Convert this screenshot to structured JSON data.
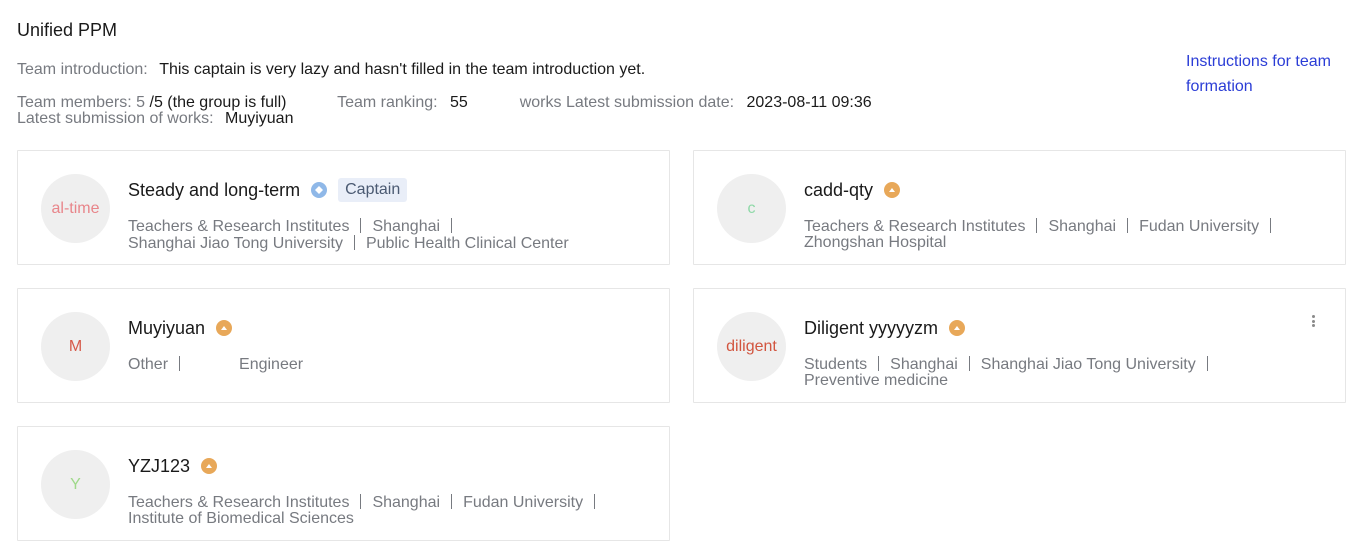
{
  "team": {
    "name": "Unified PPM",
    "intro_label": "Team introduction:",
    "intro_text": "This captain is very lazy and hasn't filled in the team introduction yet.",
    "members_label": "Team members: 5",
    "members_value": "/5 (the group is full)",
    "ranking_label": "Team ranking:",
    "ranking_value": "55",
    "works_date_label": "works Latest submission date:",
    "works_date_value": "2023-08-11 09:36",
    "latest_submitter_label": "Latest submission of works:",
    "latest_submitter_value": "Muyiyuan"
  },
  "instructions_link": "Instructions for team formation",
  "members": [
    {
      "avatar_text": "al-time",
      "avatar_color": "#e8858a",
      "name": "Steady and long-term",
      "role": "captain",
      "tag": "Captain",
      "line1": [
        "Teachers & Research Institutes",
        "Shanghai",
        ""
      ],
      "line2": [
        "Shanghai Jiao Tong University",
        "Public Health Clinical Center"
      ]
    },
    {
      "avatar_text": "c",
      "avatar_color": "#8fd9a8",
      "name": "cadd-qty",
      "role": "member",
      "line1": [
        "Teachers & Research Institutes",
        "Shanghai",
        "Fudan University",
        ""
      ],
      "line2": [
        "Zhongshan Hospital"
      ]
    },
    {
      "avatar_text": "M",
      "avatar_color": "#d65a4a",
      "name": "Muyiyuan",
      "role": "member",
      "line1": [
        "Other",
        "Engineer"
      ],
      "line2": []
    },
    {
      "avatar_text": "diligent",
      "avatar_color": "#d2553f",
      "name": "Diligent yyyyyzm",
      "role": "member",
      "line1": [
        "Students",
        "Shanghai",
        "Shanghai Jiao Tong University",
        ""
      ],
      "line2": [
        "Preventive medicine"
      ]
    },
    {
      "avatar_text": "Y",
      "avatar_color": "#9fd98a",
      "name": "YZJ123",
      "role": "member",
      "line1": [
        "Teachers & Research Institutes",
        "Shanghai",
        "Fudan University",
        ""
      ],
      "line2": [
        "Institute of Biomedical Sciences"
      ]
    }
  ],
  "icons": {
    "captain_badge": "diamond-badge-icon",
    "member_badge": "chevron-up-badge-icon",
    "more": "more-vertical-icon"
  }
}
